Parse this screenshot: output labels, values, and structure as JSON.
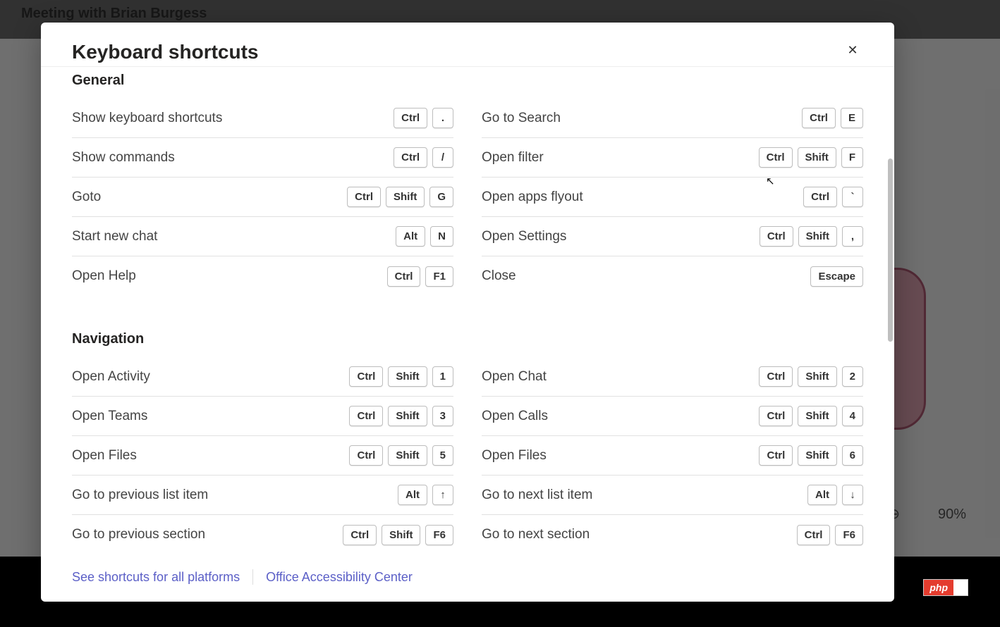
{
  "backdrop": {
    "meeting_title": "Meeting with Brian Burgess"
  },
  "modal": {
    "title": "Keyboard shortcuts",
    "sections": [
      {
        "title": "General",
        "left": [
          {
            "label": "Show keyboard shortcuts",
            "keys": [
              "Ctrl",
              "."
            ]
          },
          {
            "label": "Show commands",
            "keys": [
              "Ctrl",
              "/"
            ]
          },
          {
            "label": "Goto",
            "keys": [
              "Ctrl",
              "Shift",
              "G"
            ]
          },
          {
            "label": "Start new chat",
            "keys": [
              "Alt",
              "N"
            ]
          },
          {
            "label": "Open Help",
            "keys": [
              "Ctrl",
              "F1"
            ]
          }
        ],
        "right": [
          {
            "label": "Go to Search",
            "keys": [
              "Ctrl",
              "E"
            ]
          },
          {
            "label": "Open filter",
            "keys": [
              "Ctrl",
              "Shift",
              "F"
            ]
          },
          {
            "label": "Open apps flyout",
            "keys": [
              "Ctrl",
              "`"
            ]
          },
          {
            "label": "Open Settings",
            "keys": [
              "Ctrl",
              "Shift",
              ","
            ]
          },
          {
            "label": "Close",
            "keys": [
              "Escape"
            ]
          }
        ]
      },
      {
        "title": "Navigation",
        "left": [
          {
            "label": "Open Activity",
            "keys": [
              "Ctrl",
              "Shift",
              "1"
            ]
          },
          {
            "label": "Open Teams",
            "keys": [
              "Ctrl",
              "Shift",
              "3"
            ]
          },
          {
            "label": "Open Files",
            "keys": [
              "Ctrl",
              "Shift",
              "5"
            ]
          },
          {
            "label": "Go to previous list item",
            "keys": [
              "Alt",
              "↑"
            ]
          },
          {
            "label": "Go to previous section",
            "keys": [
              "Ctrl",
              "Shift",
              "F6"
            ]
          }
        ],
        "right": [
          {
            "label": "Open Chat",
            "keys": [
              "Ctrl",
              "Shift",
              "2"
            ]
          },
          {
            "label": "Open Calls",
            "keys": [
              "Ctrl",
              "Shift",
              "4"
            ]
          },
          {
            "label": "Open Files",
            "keys": [
              "Ctrl",
              "Shift",
              "6"
            ]
          },
          {
            "label": "Go to next list item",
            "keys": [
              "Alt",
              "↓"
            ]
          },
          {
            "label": "Go to next section",
            "keys": [
              "Ctrl",
              "F6"
            ]
          }
        ]
      }
    ],
    "footer": {
      "all_platforms": "See shortcuts for all platforms",
      "accessibility": "Office Accessibility Center"
    }
  },
  "toolbar": {
    "zoom_out_glyph": "⊖",
    "zoom_pct": "90%"
  },
  "badge": {
    "php": "php",
    "rest": ""
  }
}
